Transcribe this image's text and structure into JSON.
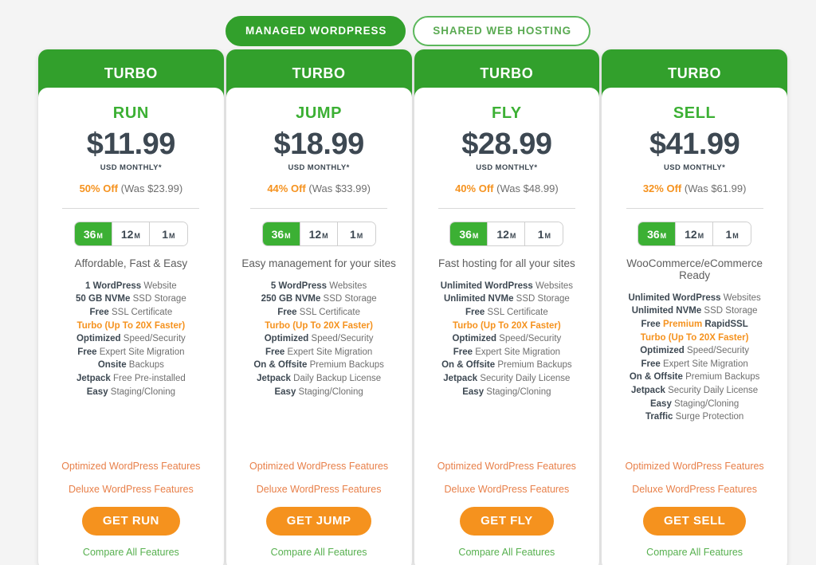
{
  "toggle": {
    "options": [
      {
        "label": "MANAGED WORDPRESS",
        "active": true
      },
      {
        "label": "SHARED WEB HOSTING",
        "active": false
      }
    ]
  },
  "colors": {
    "green": "#32a02c",
    "plan_green": "#3cb034",
    "orange": "#f5921e",
    "link_orange": "#e8804a",
    "link_green": "#57b04f",
    "price_dark": "#3d4852",
    "page_bg": "#f4f4f4"
  },
  "cards": [
    {
      "header": "TURBO",
      "plan": "RUN",
      "price": "$11.99",
      "price_unit": "USD MONTHLY*",
      "discount_pct": "50% Off",
      "discount_was": "(Was $23.99)",
      "terms": [
        {
          "value": "36",
          "unit": "M",
          "active": true
        },
        {
          "value": "12",
          "unit": "M",
          "active": false
        },
        {
          "value": "1",
          "unit": "M",
          "active": false
        }
      ],
      "tagline": "Affordable, Fast & Easy",
      "features": [
        {
          "bold": "1 WordPress",
          "rest": " Website"
        },
        {
          "bold": "50 GB NVMe",
          "rest": " SSD Storage"
        },
        {
          "bold": "Free",
          "rest": " SSL Certificate"
        },
        {
          "highlight_all": "Turbo (Up To 20X Faster)"
        },
        {
          "bold": "Optimized",
          "rest": " Speed/Security"
        },
        {
          "bold": "Free",
          "rest": " Expert Site Migration"
        },
        {
          "bold": "Onsite",
          "rest": " Backups"
        },
        {
          "bold": "Jetpack",
          "rest": " Free Pre-installed"
        },
        {
          "bold": "Easy",
          "rest": " Staging/Cloning"
        }
      ],
      "link_optimized": "Optimized WordPress Features",
      "link_deluxe": "Deluxe WordPress Features",
      "cta": "GET RUN",
      "compare": "Compare All Features"
    },
    {
      "header": "TURBO",
      "plan": "JUMP",
      "price": "$18.99",
      "price_unit": "USD MONTHLY*",
      "discount_pct": "44% Off",
      "discount_was": "(Was $33.99)",
      "terms": [
        {
          "value": "36",
          "unit": "M",
          "active": true
        },
        {
          "value": "12",
          "unit": "M",
          "active": false
        },
        {
          "value": "1",
          "unit": "M",
          "active": false
        }
      ],
      "tagline": "Easy management for your sites",
      "features": [
        {
          "bold": "5 WordPress",
          "rest": " Websites"
        },
        {
          "bold": "250 GB NVMe",
          "rest": " SSD Storage"
        },
        {
          "bold": "Free",
          "rest": " SSL Certificate"
        },
        {
          "highlight_all": "Turbo (Up To 20X Faster)"
        },
        {
          "bold": "Optimized",
          "rest": " Speed/Security"
        },
        {
          "bold": "Free",
          "rest": " Expert Site Migration"
        },
        {
          "bold": "On & Offsite",
          "rest": " Premium Backups"
        },
        {
          "bold": "Jetpack",
          "rest": " Daily Backup License"
        },
        {
          "bold": "Easy",
          "rest": " Staging/Cloning"
        }
      ],
      "link_optimized": "Optimized WordPress Features",
      "link_deluxe": "Deluxe WordPress Features",
      "cta": "GET JUMP",
      "compare": "Compare All Features"
    },
    {
      "header": "TURBO",
      "plan": "FLY",
      "price": "$28.99",
      "price_unit": "USD MONTHLY*",
      "discount_pct": "40% Off",
      "discount_was": "(Was $48.99)",
      "terms": [
        {
          "value": "36",
          "unit": "M",
          "active": true
        },
        {
          "value": "12",
          "unit": "M",
          "active": false
        },
        {
          "value": "1",
          "unit": "M",
          "active": false
        }
      ],
      "tagline": "Fast hosting for all your sites",
      "features": [
        {
          "bold": "Unlimited WordPress",
          "rest": " Websites"
        },
        {
          "bold": "Unlimited NVMe",
          "rest": " SSD Storage"
        },
        {
          "bold": "Free",
          "rest": " SSL Certificate"
        },
        {
          "highlight_all": "Turbo (Up To 20X Faster)"
        },
        {
          "bold": "Optimized",
          "rest": " Speed/Security"
        },
        {
          "bold": "Free",
          "rest": " Expert Site Migration"
        },
        {
          "bold": "On & Offsite",
          "rest": " Premium Backups"
        },
        {
          "bold": "Jetpack",
          "rest": " Security Daily License"
        },
        {
          "bold": "Easy",
          "rest": " Staging/Cloning"
        }
      ],
      "link_optimized": "Optimized WordPress Features",
      "link_deluxe": "Deluxe WordPress Features",
      "cta": "GET FLY",
      "compare": "Compare All Features"
    },
    {
      "header": "TURBO",
      "plan": "SELL",
      "price": "$41.99",
      "price_unit": "USD MONTHLY*",
      "discount_pct": "32% Off",
      "discount_was": "(Was $61.99)",
      "terms": [
        {
          "value": "36",
          "unit": "M",
          "active": true
        },
        {
          "value": "12",
          "unit": "M",
          "active": false
        },
        {
          "value": "1",
          "unit": "M",
          "active": false
        }
      ],
      "tagline": "WooCommerce/eCommerce Ready",
      "features": [
        {
          "bold": "Unlimited WordPress",
          "rest": " Websites"
        },
        {
          "bold": "Unlimited NVMe",
          "rest": " SSD Storage"
        },
        {
          "bold": "Free ",
          "highlight": "Premium",
          "bold2": " RapidSSL"
        },
        {
          "highlight_all": "Turbo (Up To 20X Faster)"
        },
        {
          "bold": "Optimized",
          "rest": " Speed/Security"
        },
        {
          "bold": "Free",
          "rest": " Expert Site Migration"
        },
        {
          "bold": "On & Offsite",
          "rest": " Premium Backups"
        },
        {
          "bold": "Jetpack",
          "rest": " Security Daily License"
        },
        {
          "bold": "Easy",
          "rest": " Staging/Cloning"
        },
        {
          "bold": "Traffic",
          "rest": " Surge Protection"
        }
      ],
      "link_optimized": "Optimized WordPress Features",
      "link_deluxe": "Deluxe WordPress Features",
      "cta": "GET SELL",
      "compare": "Compare All Features"
    }
  ]
}
